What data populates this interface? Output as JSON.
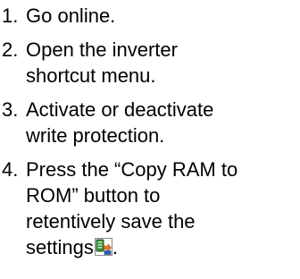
{
  "steps": [
    {
      "number": "1.",
      "lines": [
        "Go online."
      ]
    },
    {
      "number": "2.",
      "lines": [
        "Open the inverter",
        "shortcut menu."
      ]
    },
    {
      "number": "3.",
      "lines": [
        "Activate or deactivate",
        "write protection."
      ]
    },
    {
      "number": "4.",
      "lines": [
        "Press the “Copy RAM to",
        "ROM” button to",
        "retentively save the",
        "settings"
      ],
      "trailing_text": "."
    }
  ],
  "icons": {
    "copy_ram_to_rom": "copy-ram-to-rom-icon"
  },
  "colors": {
    "text": "#000000",
    "icon_green": "#3d8f3d",
    "icon_blue": "#2a5fb8",
    "icon_orange": "#e8782a"
  }
}
